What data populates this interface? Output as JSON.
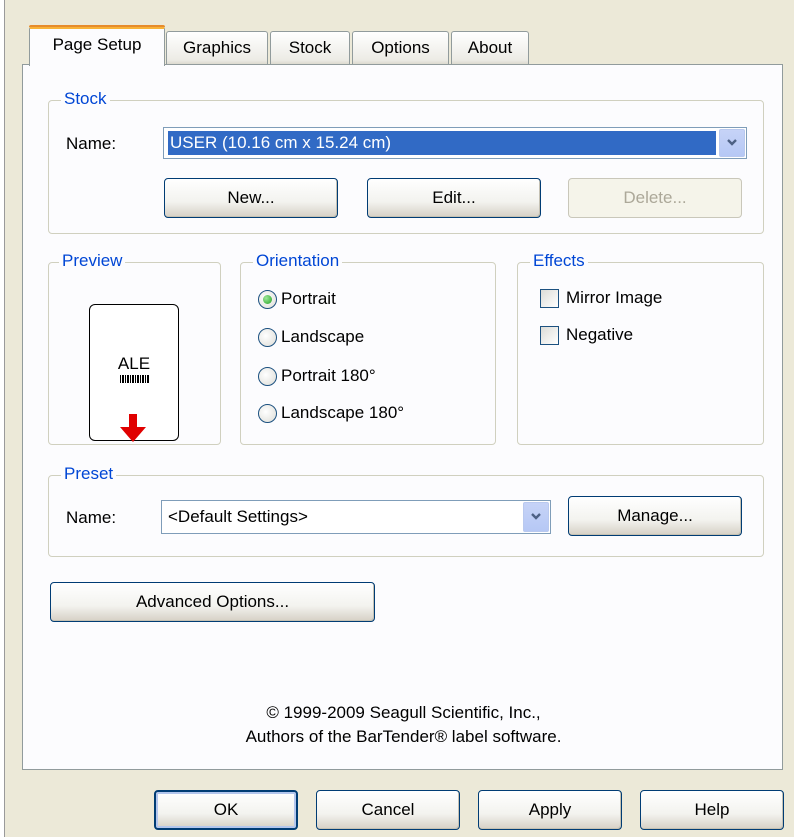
{
  "tabs": [
    "Page Setup",
    "Graphics",
    "Stock",
    "Options",
    "About"
  ],
  "active_tab": "Page Setup",
  "stock": {
    "title": "Stock",
    "name_label": "Name:",
    "name_value": "USER (10.16 cm x 15.24 cm)",
    "new_label": "New...",
    "edit_label": "Edit...",
    "delete_label": "Delete..."
  },
  "preview": {
    "title": "Preview",
    "card_text": "ALE"
  },
  "orientation": {
    "title": "Orientation",
    "options": [
      "Portrait",
      "Landscape",
      "Portrait 180°",
      "Landscape 180°"
    ],
    "selected": "Portrait"
  },
  "effects": {
    "title": "Effects",
    "mirror_label": "Mirror Image",
    "negative_label": "Negative",
    "mirror_checked": false,
    "negative_checked": false
  },
  "preset": {
    "title": "Preset",
    "name_label": "Name:",
    "name_value": "<Default Settings>",
    "manage_label": "Manage..."
  },
  "advanced_label": "Advanced Options...",
  "copyright": {
    "line1": "© 1999-2009 Seagull Scientific, Inc.,",
    "line2": "Authors of the BarTender® label software."
  },
  "buttons": {
    "ok": "OK",
    "cancel": "Cancel",
    "apply": "Apply",
    "help": "Help"
  },
  "colors": {
    "group_title": "#0046d5",
    "selection": "#316ac5",
    "active_tab_accent": "#f8b237",
    "arrow_red": "#e00000"
  }
}
